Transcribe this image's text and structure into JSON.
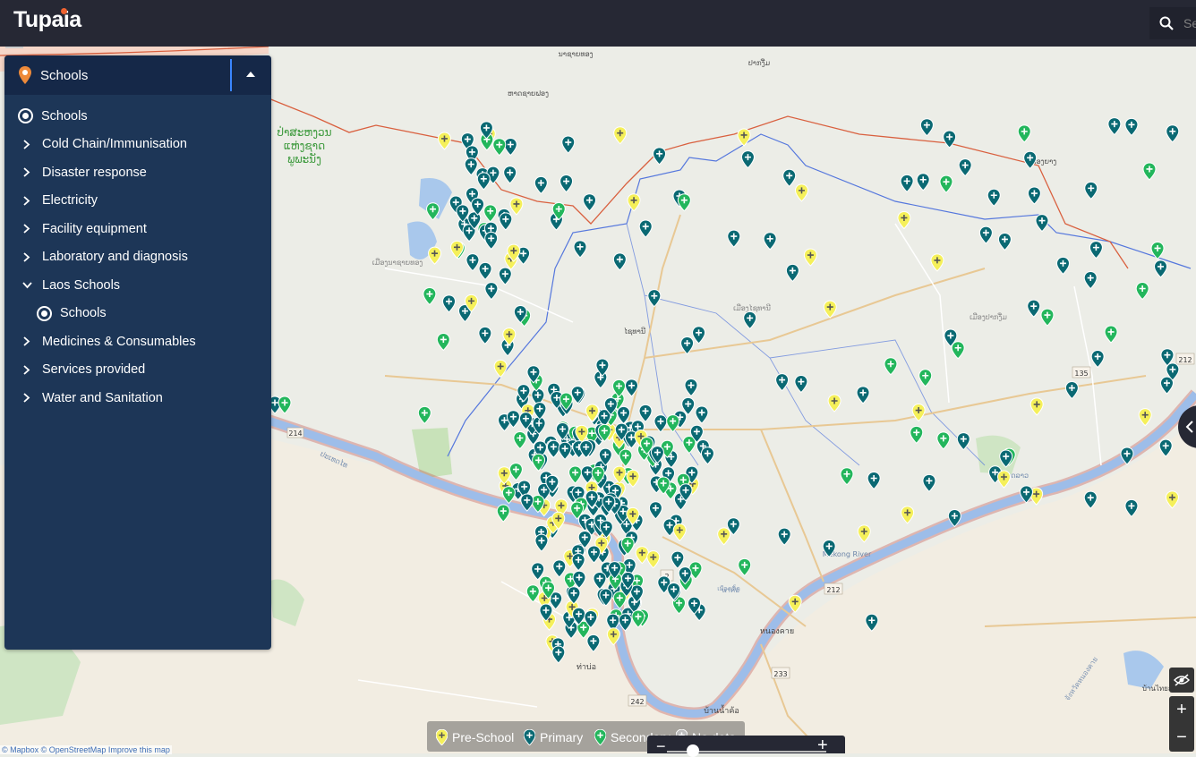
{
  "app": {
    "logo": "Tupaia",
    "search_placeholder": "Se"
  },
  "layer_panel": {
    "selected_group": "Schools",
    "items": [
      {
        "label": "Schools",
        "kind": "radio-selected",
        "indent": 0
      },
      {
        "label": "Cold Chain/Immunisation",
        "kind": "collapsed"
      },
      {
        "label": "Disaster response",
        "kind": "collapsed"
      },
      {
        "label": "Electricity",
        "kind": "collapsed"
      },
      {
        "label": "Facility equipment",
        "kind": "collapsed"
      },
      {
        "label": "Laboratory and diagnosis",
        "kind": "collapsed"
      },
      {
        "label": "Laos Schools",
        "kind": "expanded"
      },
      {
        "label": "Schools",
        "kind": "radio-selected",
        "indent": 1
      },
      {
        "label": "Medicines & Consumables",
        "kind": "collapsed"
      },
      {
        "label": "Services provided",
        "kind": "collapsed"
      },
      {
        "label": "Water and Sanitation",
        "kind": "collapsed"
      }
    ]
  },
  "legend": [
    {
      "label": "Pre-School",
      "color": "#f5f05a"
    },
    {
      "label": "Primary",
      "color": "#0a6973"
    },
    {
      "label": "Secondary",
      "color": "#23b65c"
    },
    {
      "label": "No data",
      "color": "#bdbdbd"
    }
  ],
  "map": {
    "attribution": "© Mapbox © OpenStreetMap Improve this map",
    "place_labels": [
      "ປ່າສະຫງວນ",
      "ແຫ່ງຊາດ",
      "ພູພະນັງ",
      "ເມືອງນາຊາຍທອງ",
      "ເມືອງໄຊທານີ",
      "ເມືອງປາກງື່ມ",
      "ປະເທດໄທ",
      "ປະເທດລາວ",
      "Mekong River",
      "หนองคาย",
      "บ้านไทยสวรรค์",
      "ท่าบ่อ",
      "บ้านน้ำค้อ",
      "นาค้อ",
      "จังหวัดหนองคาย",
      "เมืองเล็ก",
      "ໄຊທານີ",
      "ນາຊາຍທອງ",
      "ຫາດຊາຍຟອງ",
      "ປາກງື່ມ",
      "ຫນອງຍາງ"
    ],
    "road_shields": [
      "214",
      "212",
      "135",
      "233",
      "242",
      "212",
      "2"
    ]
  },
  "colors": {
    "topbar": "#262834",
    "panel": "#1d3657",
    "panel_header": "#152848",
    "pin_primary": "#0a6973",
    "pin_preschool": "#f5f05a",
    "pin_secondary": "#23b65c"
  }
}
